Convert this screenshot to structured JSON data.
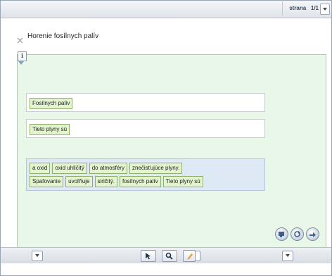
{
  "header": {
    "page_label": "strana",
    "page_value": "1/1"
  },
  "title": "Horenie fosílnych palív",
  "info_label": "i",
  "sentences": [
    {
      "placed_chip": "Fosílnych palív"
    },
    {
      "placed_chip": "Tieto plyny sú"
    }
  ],
  "word_bank": {
    "row1": [
      "a oxid",
      "oxid uhličitý",
      "do atmosféry",
      "znečisťujúce plyny."
    ],
    "row2": [
      "Spaľovanie",
      "uvoľňuje",
      "siričitý.",
      "fosílnych palív",
      "Tieto plyny sú"
    ]
  },
  "colors": {
    "panel_bg": "#e9f7e9",
    "chip_bg": "#e3f4cf",
    "bank_bg": "#dfe9f5"
  },
  "icons": [
    "collapse-icon",
    "info-icon",
    "check-icon",
    "reset-icon",
    "next-icon",
    "prev-arrow-icon",
    "next-arrow-icon",
    "pointer-icon",
    "zoom-icon",
    "pen-icon"
  ]
}
